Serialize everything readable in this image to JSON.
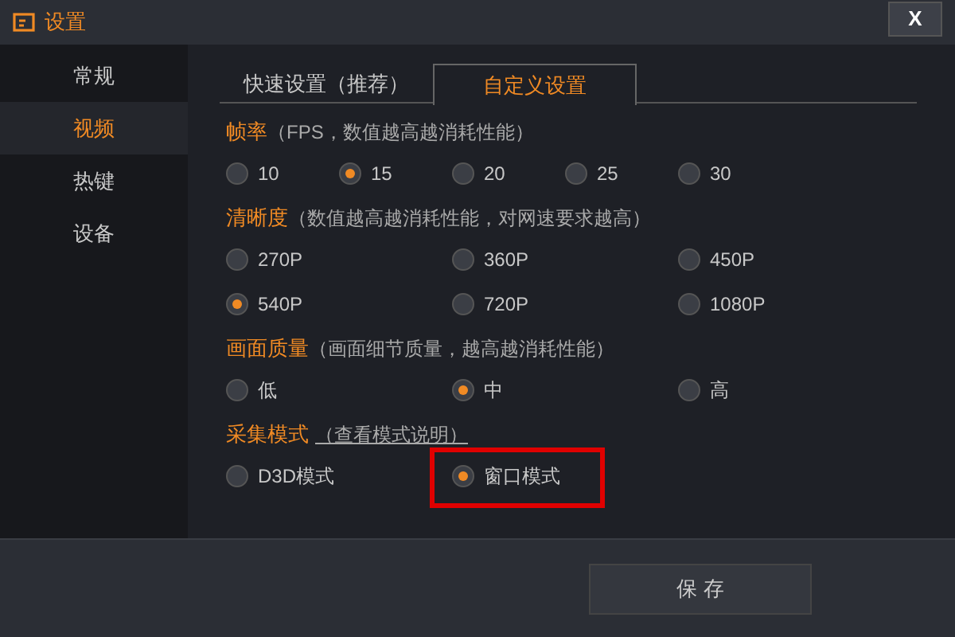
{
  "window": {
    "title": "设置",
    "close": "X"
  },
  "sidebar": {
    "items": [
      {
        "label": "常规",
        "selected": false
      },
      {
        "label": "视频",
        "selected": true
      },
      {
        "label": "热键",
        "selected": false
      },
      {
        "label": "设备",
        "selected": false
      }
    ]
  },
  "tabs": [
    {
      "label": "快速设置（推荐）",
      "selected": false
    },
    {
      "label": "自定义设置",
      "selected": true
    }
  ],
  "sections": [
    {
      "title": "帧率",
      "note": "（FPS，数值越高越消耗性能）",
      "options": [
        {
          "label": "10",
          "selected": false
        },
        {
          "label": "15",
          "selected": true
        },
        {
          "label": "20",
          "selected": false
        },
        {
          "label": "25",
          "selected": false
        },
        {
          "label": "30",
          "selected": false
        }
      ]
    },
    {
      "title": "清晰度",
      "note": "（数值越高越消耗性能，对网速要求越高）",
      "options": [
        {
          "label": "270P",
          "selected": false
        },
        {
          "label": "360P",
          "selected": false
        },
        {
          "label": "450P",
          "selected": false
        },
        {
          "label": "540P",
          "selected": true
        },
        {
          "label": "720P",
          "selected": false
        },
        {
          "label": "1080P",
          "selected": false
        }
      ]
    },
    {
      "title": "画面质量",
      "note": "（画面细节质量，越高越消耗性能）",
      "options": [
        {
          "label": "低",
          "selected": false
        },
        {
          "label": "中",
          "selected": true
        },
        {
          "label": "高",
          "selected": false
        }
      ]
    },
    {
      "title": "采集模式",
      "link": "（查看模式说明）",
      "options": [
        {
          "label": "D3D模式",
          "selected": false
        },
        {
          "label": "窗口模式",
          "selected": true,
          "highlighted": true
        }
      ]
    }
  ],
  "save_button": "保 存"
}
